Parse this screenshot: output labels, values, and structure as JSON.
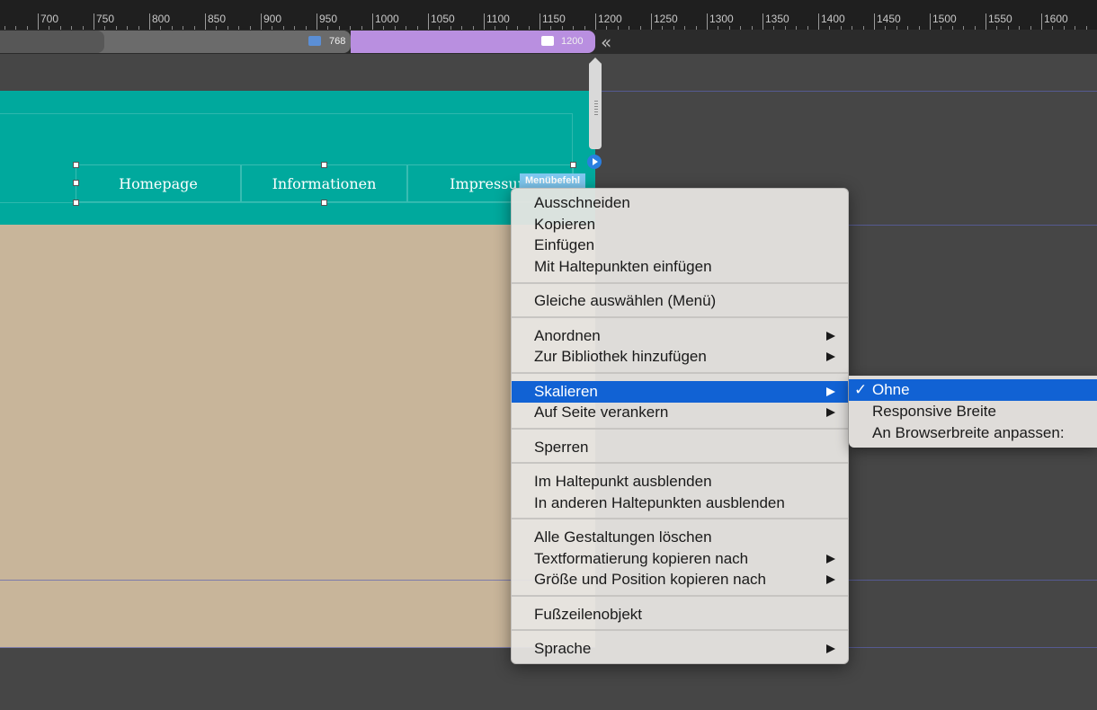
{
  "ruler": {
    "labels": [
      "700",
      "750",
      "800",
      "850",
      "900",
      "950",
      "1000",
      "1050",
      "1100",
      "1150",
      "1200",
      "1250",
      "1300",
      "1350",
      "1400",
      "1450",
      "1500",
      "1550",
      "1600"
    ]
  },
  "breakpoints": {
    "tablet_label": "768",
    "desktop_label": "1200",
    "tablet_icon_color": "#5b8fd6",
    "collapse_icon": "double-chevron-left-icon"
  },
  "canvas": {
    "header_color": "#00a99d",
    "body_color": "#c8b59a",
    "menu_items": [
      "Homepage",
      "Informationen",
      "Impressum"
    ],
    "selection_tag": "Menübefehl"
  },
  "context_menu": {
    "groups": [
      [
        "Ausschneiden",
        "Kopieren",
        "Einfügen",
        "Mit Haltepunkten einfügen"
      ],
      [
        "Gleiche auswählen (Menü)"
      ],
      [
        "Anordnen",
        "Zur Bibliothek hinzufügen"
      ],
      [
        "Skalieren",
        "Auf Seite verankern"
      ],
      [
        "Sperren"
      ],
      [
        "Im Haltepunkt ausblenden",
        "In anderen Haltepunkten ausblenden"
      ],
      [
        "Alle Gestaltungen löschen",
        "Textformatierung kopieren nach",
        "Größe und Position kopieren nach"
      ],
      [
        "Fußzeilenobjekt"
      ],
      [
        "Sprache"
      ]
    ],
    "active_item": "Skalieren",
    "submenu_items": [
      "Anordnen",
      "Zur Bibliothek hinzufügen",
      "Skalieren",
      "Auf Seite verankern",
      "Textformatierung kopieren nach",
      "Größe und Position kopieren nach",
      "Sprache"
    ],
    "highlight_color": "#1162d4"
  },
  "scale_submenu": {
    "items": [
      "Ohne",
      "Responsive Breite",
      "An Browserbreite anpassen:"
    ],
    "checked": "Ohne",
    "check_glyph": "✓"
  }
}
